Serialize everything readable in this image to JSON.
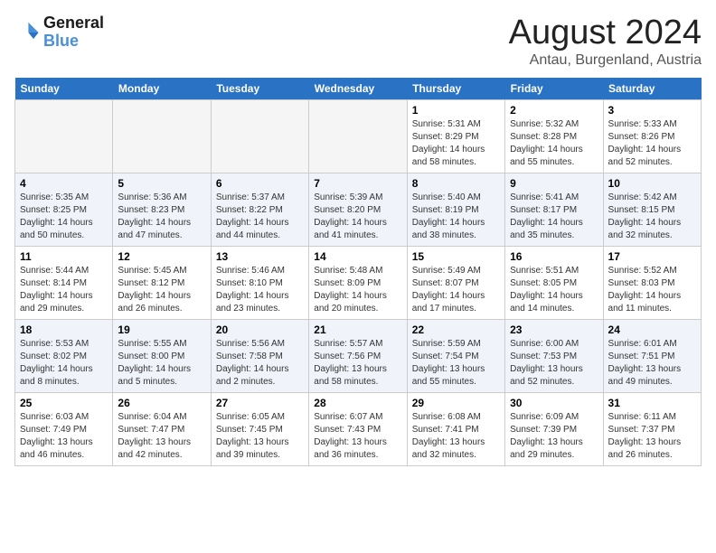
{
  "header": {
    "logo_line1": "General",
    "logo_line2": "Blue",
    "title": "August 2024",
    "subtitle": "Antau, Burgenland, Austria"
  },
  "days_of_week": [
    "Sunday",
    "Monday",
    "Tuesday",
    "Wednesday",
    "Thursday",
    "Friday",
    "Saturday"
  ],
  "weeks": [
    [
      {
        "day": "",
        "info": ""
      },
      {
        "day": "",
        "info": ""
      },
      {
        "day": "",
        "info": ""
      },
      {
        "day": "",
        "info": ""
      },
      {
        "day": "1",
        "info": "Sunrise: 5:31 AM\nSunset: 8:29 PM\nDaylight: 14 hours\nand 58 minutes."
      },
      {
        "day": "2",
        "info": "Sunrise: 5:32 AM\nSunset: 8:28 PM\nDaylight: 14 hours\nand 55 minutes."
      },
      {
        "day": "3",
        "info": "Sunrise: 5:33 AM\nSunset: 8:26 PM\nDaylight: 14 hours\nand 52 minutes."
      }
    ],
    [
      {
        "day": "4",
        "info": "Sunrise: 5:35 AM\nSunset: 8:25 PM\nDaylight: 14 hours\nand 50 minutes."
      },
      {
        "day": "5",
        "info": "Sunrise: 5:36 AM\nSunset: 8:23 PM\nDaylight: 14 hours\nand 47 minutes."
      },
      {
        "day": "6",
        "info": "Sunrise: 5:37 AM\nSunset: 8:22 PM\nDaylight: 14 hours\nand 44 minutes."
      },
      {
        "day": "7",
        "info": "Sunrise: 5:39 AM\nSunset: 8:20 PM\nDaylight: 14 hours\nand 41 minutes."
      },
      {
        "day": "8",
        "info": "Sunrise: 5:40 AM\nSunset: 8:19 PM\nDaylight: 14 hours\nand 38 minutes."
      },
      {
        "day": "9",
        "info": "Sunrise: 5:41 AM\nSunset: 8:17 PM\nDaylight: 14 hours\nand 35 minutes."
      },
      {
        "day": "10",
        "info": "Sunrise: 5:42 AM\nSunset: 8:15 PM\nDaylight: 14 hours\nand 32 minutes."
      }
    ],
    [
      {
        "day": "11",
        "info": "Sunrise: 5:44 AM\nSunset: 8:14 PM\nDaylight: 14 hours\nand 29 minutes."
      },
      {
        "day": "12",
        "info": "Sunrise: 5:45 AM\nSunset: 8:12 PM\nDaylight: 14 hours\nand 26 minutes."
      },
      {
        "day": "13",
        "info": "Sunrise: 5:46 AM\nSunset: 8:10 PM\nDaylight: 14 hours\nand 23 minutes."
      },
      {
        "day": "14",
        "info": "Sunrise: 5:48 AM\nSunset: 8:09 PM\nDaylight: 14 hours\nand 20 minutes."
      },
      {
        "day": "15",
        "info": "Sunrise: 5:49 AM\nSunset: 8:07 PM\nDaylight: 14 hours\nand 17 minutes."
      },
      {
        "day": "16",
        "info": "Sunrise: 5:51 AM\nSunset: 8:05 PM\nDaylight: 14 hours\nand 14 minutes."
      },
      {
        "day": "17",
        "info": "Sunrise: 5:52 AM\nSunset: 8:03 PM\nDaylight: 14 hours\nand 11 minutes."
      }
    ],
    [
      {
        "day": "18",
        "info": "Sunrise: 5:53 AM\nSunset: 8:02 PM\nDaylight: 14 hours\nand 8 minutes."
      },
      {
        "day": "19",
        "info": "Sunrise: 5:55 AM\nSunset: 8:00 PM\nDaylight: 14 hours\nand 5 minutes."
      },
      {
        "day": "20",
        "info": "Sunrise: 5:56 AM\nSunset: 7:58 PM\nDaylight: 14 hours\nand 2 minutes."
      },
      {
        "day": "21",
        "info": "Sunrise: 5:57 AM\nSunset: 7:56 PM\nDaylight: 13 hours\nand 58 minutes."
      },
      {
        "day": "22",
        "info": "Sunrise: 5:59 AM\nSunset: 7:54 PM\nDaylight: 13 hours\nand 55 minutes."
      },
      {
        "day": "23",
        "info": "Sunrise: 6:00 AM\nSunset: 7:53 PM\nDaylight: 13 hours\nand 52 minutes."
      },
      {
        "day": "24",
        "info": "Sunrise: 6:01 AM\nSunset: 7:51 PM\nDaylight: 13 hours\nand 49 minutes."
      }
    ],
    [
      {
        "day": "25",
        "info": "Sunrise: 6:03 AM\nSunset: 7:49 PM\nDaylight: 13 hours\nand 46 minutes."
      },
      {
        "day": "26",
        "info": "Sunrise: 6:04 AM\nSunset: 7:47 PM\nDaylight: 13 hours\nand 42 minutes."
      },
      {
        "day": "27",
        "info": "Sunrise: 6:05 AM\nSunset: 7:45 PM\nDaylight: 13 hours\nand 39 minutes."
      },
      {
        "day": "28",
        "info": "Sunrise: 6:07 AM\nSunset: 7:43 PM\nDaylight: 13 hours\nand 36 minutes."
      },
      {
        "day": "29",
        "info": "Sunrise: 6:08 AM\nSunset: 7:41 PM\nDaylight: 13 hours\nand 32 minutes."
      },
      {
        "day": "30",
        "info": "Sunrise: 6:09 AM\nSunset: 7:39 PM\nDaylight: 13 hours\nand 29 minutes."
      },
      {
        "day": "31",
        "info": "Sunrise: 6:11 AM\nSunset: 7:37 PM\nDaylight: 13 hours\nand 26 minutes."
      }
    ]
  ]
}
